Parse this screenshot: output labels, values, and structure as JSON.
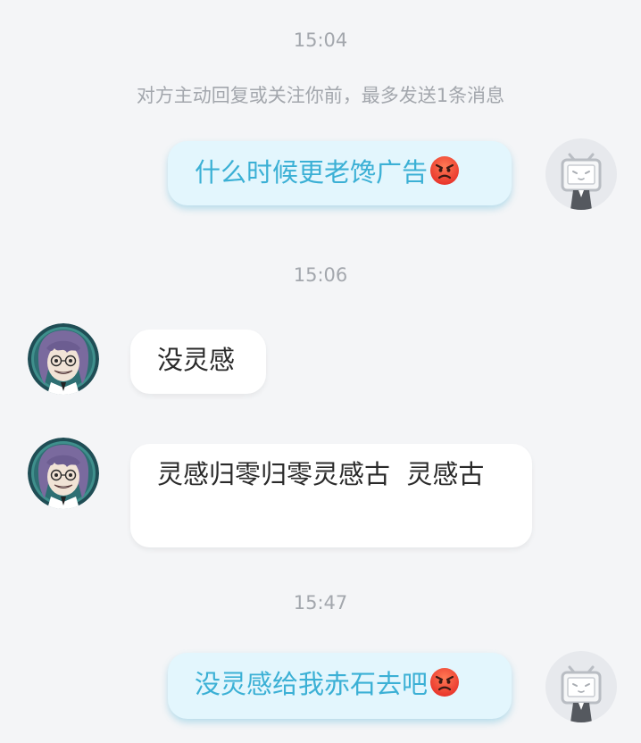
{
  "chat": {
    "timestamps": [
      "15:04",
      "15:06",
      "15:47"
    ],
    "notice": "对方主动回复或关注你前，最多发送1条消息",
    "messages": [
      {
        "side": "right",
        "text": "什么时候更老馋广告",
        "emoji": "angry-face"
      },
      {
        "side": "left",
        "text": "没灵感"
      },
      {
        "side": "left",
        "text": "灵感归零归零灵感古  灵感古"
      },
      {
        "side": "right",
        "text": "没灵感给我赤石去吧",
        "emoji": "angry-face"
      }
    ]
  },
  "avatars": {
    "self": "bilibili-tv-icon",
    "other": "anime-character-avatar"
  },
  "colors": {
    "background": "#f4f5f7",
    "outgoing_bubble": "#e3f6fd",
    "outgoing_text": "#3bb0d5",
    "incoming_bubble": "#ffffff",
    "incoming_text": "#2a2a2a",
    "timestamp_text": "#a3a7ad"
  }
}
